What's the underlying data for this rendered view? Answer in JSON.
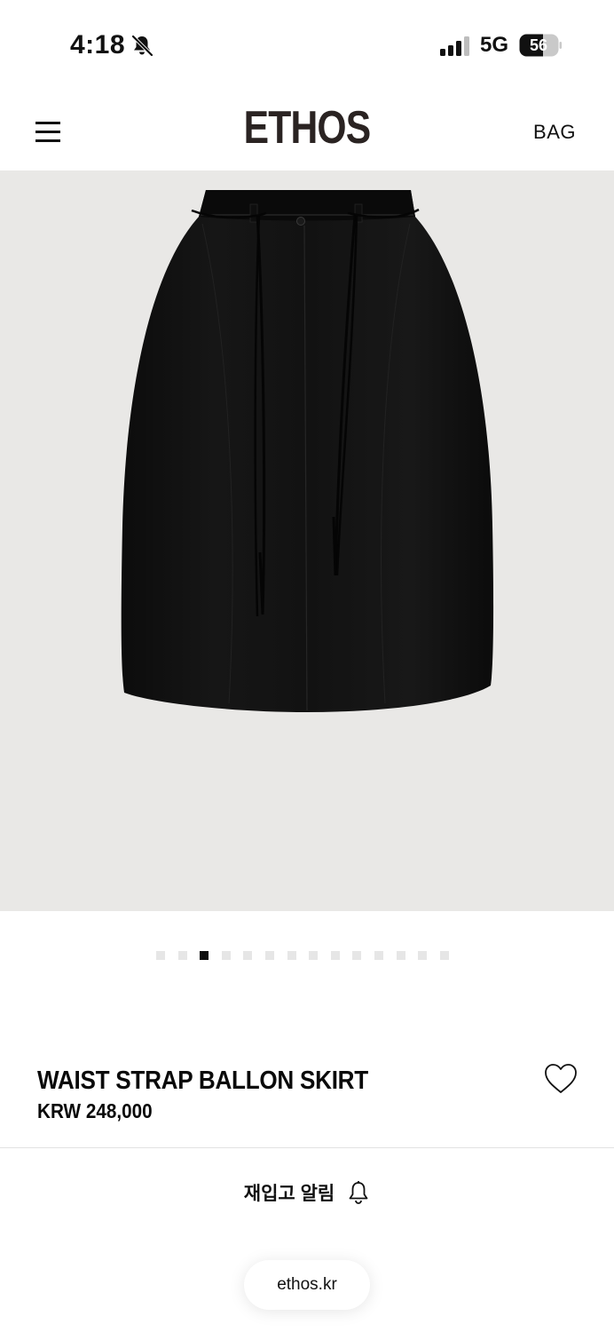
{
  "status_bar": {
    "time": "4:18",
    "network": "5G",
    "battery_level": "56",
    "icons": [
      "bell-slash-icon",
      "cellular-signal-icon",
      "battery-icon"
    ]
  },
  "header": {
    "logo": "ETHOS",
    "bag_label": "BAG",
    "icons": [
      "hamburger-menu-icon"
    ]
  },
  "gallery": {
    "image_description_icon": "product-photo",
    "background_color": "#e9e8e6",
    "total_images": 14,
    "active_index": 2
  },
  "product": {
    "name": "WAIST STRAP BALLON SKIRT",
    "price": "KRW 248,000",
    "wishlist_icon": "heart-outline-icon"
  },
  "restock": {
    "label": "재입고 알림",
    "icon": "bell-icon"
  },
  "browser": {
    "url": "ethos.kr"
  }
}
